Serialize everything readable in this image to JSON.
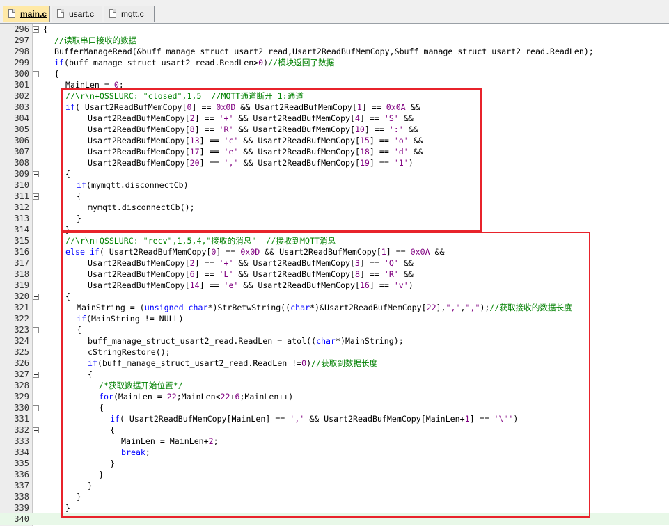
{
  "tabs": [
    {
      "label": "main.c",
      "active": true
    },
    {
      "label": "usart.c",
      "active": false
    },
    {
      "label": "mqtt.c",
      "active": false
    }
  ],
  "lines": [
    {
      "n": "296",
      "indent": 0,
      "fold": true,
      "seg": [
        [
          "p",
          "{"
        ]
      ]
    },
    {
      "n": "297",
      "indent": 2,
      "seg": [
        [
          "c",
          "//读取串口接收的数据"
        ]
      ]
    },
    {
      "n": "298",
      "indent": 2,
      "seg": [
        [
          "p",
          "BufferManageRead(&buff_manage_struct_usart2_read,Usart2ReadBufMemCopy,&buff_manage_struct_usart2_read.ReadLen);"
        ]
      ]
    },
    {
      "n": "299",
      "indent": 2,
      "seg": [
        [
          "k",
          "if"
        ],
        [
          "p",
          "(buff_manage_struct_usart2_read.ReadLen>"
        ],
        [
          "n",
          "0"
        ],
        [
          "p",
          ")"
        ],
        [
          "c",
          "//模块返回了数据"
        ]
      ]
    },
    {
      "n": "300",
      "indent": 2,
      "fold": true,
      "seg": [
        [
          "p",
          "{"
        ]
      ]
    },
    {
      "n": "301",
      "indent": 4,
      "seg": [
        [
          "p",
          "MainLen = "
        ],
        [
          "n",
          "0"
        ],
        [
          "p",
          ";"
        ]
      ]
    },
    {
      "n": "302",
      "indent": 4,
      "seg": [
        [
          "c",
          "//\\r\\n+QSSLURC: \"closed\",1,5  //MQTT通道断开 1:通道"
        ]
      ]
    },
    {
      "n": "303",
      "indent": 4,
      "seg": [
        [
          "k",
          "if"
        ],
        [
          "p",
          "( Usart2ReadBufMemCopy["
        ],
        [
          "n",
          "0"
        ],
        [
          "p",
          "] == "
        ],
        [
          "n",
          "0x0D"
        ],
        [
          "p",
          " && Usart2ReadBufMemCopy["
        ],
        [
          "n",
          "1"
        ],
        [
          "p",
          "] == "
        ],
        [
          "n",
          "0x0A"
        ],
        [
          "p",
          " &&"
        ]
      ]
    },
    {
      "n": "304",
      "indent": 8,
      "seg": [
        [
          "p",
          "Usart2ReadBufMemCopy["
        ],
        [
          "n",
          "2"
        ],
        [
          "p",
          "] == "
        ],
        [
          "s",
          "'+'"
        ],
        [
          "p",
          " && Usart2ReadBufMemCopy["
        ],
        [
          "n",
          "4"
        ],
        [
          "p",
          "] == "
        ],
        [
          "s",
          "'S'"
        ],
        [
          "p",
          " &&"
        ]
      ]
    },
    {
      "n": "305",
      "indent": 8,
      "seg": [
        [
          "p",
          "Usart2ReadBufMemCopy["
        ],
        [
          "n",
          "8"
        ],
        [
          "p",
          "] == "
        ],
        [
          "s",
          "'R'"
        ],
        [
          "p",
          " && Usart2ReadBufMemCopy["
        ],
        [
          "n",
          "10"
        ],
        [
          "p",
          "] == "
        ],
        [
          "s",
          "':'"
        ],
        [
          "p",
          " &&"
        ]
      ]
    },
    {
      "n": "306",
      "indent": 8,
      "seg": [
        [
          "p",
          "Usart2ReadBufMemCopy["
        ],
        [
          "n",
          "13"
        ],
        [
          "p",
          "] == "
        ],
        [
          "s",
          "'c'"
        ],
        [
          "p",
          " && Usart2ReadBufMemCopy["
        ],
        [
          "n",
          "15"
        ],
        [
          "p",
          "] == "
        ],
        [
          "s",
          "'o'"
        ],
        [
          "p",
          " &&"
        ]
      ]
    },
    {
      "n": "307",
      "indent": 8,
      "seg": [
        [
          "p",
          "Usart2ReadBufMemCopy["
        ],
        [
          "n",
          "17"
        ],
        [
          "p",
          "] == "
        ],
        [
          "s",
          "'e'"
        ],
        [
          "p",
          " && Usart2ReadBufMemCopy["
        ],
        [
          "n",
          "18"
        ],
        [
          "p",
          "] == "
        ],
        [
          "s",
          "'d'"
        ],
        [
          "p",
          " &&"
        ]
      ]
    },
    {
      "n": "308",
      "indent": 8,
      "seg": [
        [
          "p",
          "Usart2ReadBufMemCopy["
        ],
        [
          "n",
          "20"
        ],
        [
          "p",
          "] == "
        ],
        [
          "s",
          "','"
        ],
        [
          "p",
          " && Usart2ReadBufMemCopy["
        ],
        [
          "n",
          "19"
        ],
        [
          "p",
          "] == "
        ],
        [
          "s",
          "'1'"
        ],
        [
          "p",
          ")"
        ]
      ]
    },
    {
      "n": "309",
      "indent": 4,
      "fold": true,
      "seg": [
        [
          "p",
          "{"
        ]
      ]
    },
    {
      "n": "310",
      "indent": 6,
      "seg": [
        [
          "k",
          "if"
        ],
        [
          "p",
          "(mymqtt.disconnectCb)"
        ]
      ]
    },
    {
      "n": "311",
      "indent": 6,
      "fold": true,
      "seg": [
        [
          "p",
          "{"
        ]
      ]
    },
    {
      "n": "312",
      "indent": 8,
      "seg": [
        [
          "p",
          "mymqtt.disconnectCb();"
        ]
      ]
    },
    {
      "n": "313",
      "indent": 6,
      "seg": [
        [
          "p",
          "}"
        ]
      ]
    },
    {
      "n": "314",
      "indent": 4,
      "seg": [
        [
          "p",
          "}"
        ]
      ]
    },
    {
      "n": "315",
      "indent": 4,
      "seg": [
        [
          "c",
          "//\\r\\n+QSSLURC: \"recv\",1,5,4,\"接收的消息\"  //接收到MQTT消息"
        ]
      ]
    },
    {
      "n": "316",
      "indent": 4,
      "seg": [
        [
          "k",
          "else if"
        ],
        [
          "p",
          "( Usart2ReadBufMemCopy["
        ],
        [
          "n",
          "0"
        ],
        [
          "p",
          "] == "
        ],
        [
          "n",
          "0x0D"
        ],
        [
          "p",
          " && Usart2ReadBufMemCopy["
        ],
        [
          "n",
          "1"
        ],
        [
          "p",
          "] == "
        ],
        [
          "n",
          "0x0A"
        ],
        [
          "p",
          " &&"
        ]
      ]
    },
    {
      "n": "317",
      "indent": 8,
      "seg": [
        [
          "p",
          "Usart2ReadBufMemCopy["
        ],
        [
          "n",
          "2"
        ],
        [
          "p",
          "] == "
        ],
        [
          "s",
          "'+'"
        ],
        [
          "p",
          " && Usart2ReadBufMemCopy["
        ],
        [
          "n",
          "3"
        ],
        [
          "p",
          "] == "
        ],
        [
          "s",
          "'Q'"
        ],
        [
          "p",
          " &&"
        ]
      ]
    },
    {
      "n": "318",
      "indent": 8,
      "seg": [
        [
          "p",
          "Usart2ReadBufMemCopy["
        ],
        [
          "n",
          "6"
        ],
        [
          "p",
          "] == "
        ],
        [
          "s",
          "'L'"
        ],
        [
          "p",
          " && Usart2ReadBufMemCopy["
        ],
        [
          "n",
          "8"
        ],
        [
          "p",
          "] == "
        ],
        [
          "s",
          "'R'"
        ],
        [
          "p",
          " &&"
        ]
      ]
    },
    {
      "n": "319",
      "indent": 8,
      "seg": [
        [
          "p",
          "Usart2ReadBufMemCopy["
        ],
        [
          "n",
          "14"
        ],
        [
          "p",
          "] == "
        ],
        [
          "s",
          "'e'"
        ],
        [
          "p",
          " && Usart2ReadBufMemCopy["
        ],
        [
          "n",
          "16"
        ],
        [
          "p",
          "] == "
        ],
        [
          "s",
          "'v'"
        ],
        [
          "p",
          ")"
        ]
      ]
    },
    {
      "n": "320",
      "indent": 4,
      "fold": true,
      "seg": [
        [
          "p",
          "{"
        ]
      ]
    },
    {
      "n": "321",
      "indent": 6,
      "seg": [
        [
          "p",
          "MainString = ("
        ],
        [
          "k",
          "unsigned char"
        ],
        [
          "p",
          "*)StrBetwString(("
        ],
        [
          "k",
          "char"
        ],
        [
          "p",
          "*)&Usart2ReadBufMemCopy["
        ],
        [
          "n",
          "22"
        ],
        [
          "p",
          "],"
        ],
        [
          "s",
          "\",\""
        ],
        [
          "p",
          ","
        ],
        [
          "s",
          "\",\""
        ],
        [
          "p",
          ");"
        ],
        [
          "c",
          "//获取接收的数据长度"
        ]
      ]
    },
    {
      "n": "322",
      "indent": 6,
      "seg": [
        [
          "k",
          "if"
        ],
        [
          "p",
          "(MainString != NULL)"
        ]
      ]
    },
    {
      "n": "323",
      "indent": 6,
      "fold": true,
      "seg": [
        [
          "p",
          "{"
        ]
      ]
    },
    {
      "n": "324",
      "indent": 8,
      "seg": [
        [
          "p",
          "buff_manage_struct_usart2_read.ReadLen = atol(("
        ],
        [
          "k",
          "char"
        ],
        [
          "p",
          "*)MainString);"
        ]
      ]
    },
    {
      "n": "325",
      "indent": 8,
      "seg": [
        [
          "p",
          "cStringRestore();"
        ]
      ]
    },
    {
      "n": "326",
      "indent": 8,
      "seg": [
        [
          "k",
          "if"
        ],
        [
          "p",
          "(buff_manage_struct_usart2_read.ReadLen !="
        ],
        [
          "n",
          "0"
        ],
        [
          "p",
          ")"
        ],
        [
          "c",
          "//获取到数据长度"
        ]
      ]
    },
    {
      "n": "327",
      "indent": 8,
      "fold": true,
      "seg": [
        [
          "p",
          "{"
        ]
      ]
    },
    {
      "n": "328",
      "indent": 10,
      "seg": [
        [
          "c",
          "/*获取数据开始位置*/"
        ]
      ]
    },
    {
      "n": "329",
      "indent": 10,
      "seg": [
        [
          "k",
          "for"
        ],
        [
          "p",
          "(MainLen = "
        ],
        [
          "n",
          "22"
        ],
        [
          "p",
          ";MainLen<"
        ],
        [
          "n",
          "22"
        ],
        [
          "p",
          "+"
        ],
        [
          "n",
          "6"
        ],
        [
          "p",
          ";MainLen++)"
        ]
      ]
    },
    {
      "n": "330",
      "indent": 10,
      "fold": true,
      "seg": [
        [
          "p",
          "{"
        ]
      ]
    },
    {
      "n": "331",
      "indent": 12,
      "seg": [
        [
          "k",
          "if"
        ],
        [
          "p",
          "( Usart2ReadBufMemCopy[MainLen] == "
        ],
        [
          "s",
          "','"
        ],
        [
          "p",
          " && Usart2ReadBufMemCopy[MainLen+"
        ],
        [
          "n",
          "1"
        ],
        [
          "p",
          "] == "
        ],
        [
          "s",
          "'\\\"'"
        ],
        [
          "p",
          ")"
        ]
      ]
    },
    {
      "n": "332",
      "indent": 12,
      "fold": true,
      "seg": [
        [
          "p",
          "{"
        ]
      ]
    },
    {
      "n": "333",
      "indent": 14,
      "seg": [
        [
          "p",
          "MainLen = MainLen+"
        ],
        [
          "n",
          "2"
        ],
        [
          "p",
          ";"
        ]
      ]
    },
    {
      "n": "334",
      "indent": 14,
      "seg": [
        [
          "k",
          "break"
        ],
        [
          "p",
          ";"
        ]
      ]
    },
    {
      "n": "335",
      "indent": 12,
      "seg": [
        [
          "p",
          "}"
        ]
      ]
    },
    {
      "n": "336",
      "indent": 10,
      "seg": [
        [
          "p",
          "}"
        ]
      ]
    },
    {
      "n": "337",
      "indent": 8,
      "seg": [
        [
          "p",
          "}"
        ]
      ]
    },
    {
      "n": "338",
      "indent": 6,
      "seg": [
        [
          "p",
          "}"
        ]
      ]
    },
    {
      "n": "339",
      "indent": 4,
      "seg": [
        [
          "p",
          "}"
        ]
      ]
    },
    {
      "n": "340",
      "indent": 0,
      "seg": [
        [
          "p",
          ""
        ]
      ]
    }
  ],
  "colors": {
    "accent_box": "#e8232b",
    "keyword": "#0000ff",
    "number": "#800080",
    "comment": "#008000",
    "tab_active": "#ffe9a6"
  }
}
